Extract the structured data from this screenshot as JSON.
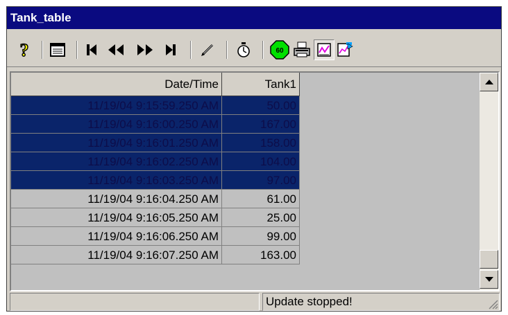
{
  "window": {
    "title": "Tank_table"
  },
  "toolbar": {
    "buttons": [
      {
        "name": "help-icon"
      },
      {
        "name": "properties-icon"
      },
      {
        "name": "first-record-icon"
      },
      {
        "name": "previous-page-icon"
      },
      {
        "name": "next-page-icon"
      },
      {
        "name": "last-record-icon"
      },
      {
        "name": "edit-icon"
      },
      {
        "name": "time-range-icon"
      },
      {
        "name": "stop-icon",
        "label": "60"
      },
      {
        "name": "print-icon"
      },
      {
        "name": "trend-icon"
      },
      {
        "name": "export-icon"
      }
    ]
  },
  "table": {
    "columns": [
      "Date/Time",
      "Tank1"
    ],
    "rows": [
      {
        "datetime": "11/19/04 9:15:59.250 AM",
        "value": "50.00",
        "selected": true
      },
      {
        "datetime": "11/19/04 9:16:00.250 AM",
        "value": "167.00",
        "selected": true
      },
      {
        "datetime": "11/19/04 9:16:01.250 AM",
        "value": "158.00",
        "selected": true
      },
      {
        "datetime": "11/19/04 9:16:02.250 AM",
        "value": "104.00",
        "selected": true
      },
      {
        "datetime": "11/19/04 9:16:03.250 AM",
        "value": "97.00",
        "selected": true
      },
      {
        "datetime": "11/19/04 9:16:04.250 AM",
        "value": "61.00",
        "selected": false
      },
      {
        "datetime": "11/19/04 9:16:05.250 AM",
        "value": "25.00",
        "selected": false
      },
      {
        "datetime": "11/19/04 9:16:06.250 AM",
        "value": "99.00",
        "selected": false
      },
      {
        "datetime": "11/19/04 9:16:07.250 AM",
        "value": "163.00",
        "selected": false
      }
    ]
  },
  "status": {
    "left": "",
    "message": "Update stopped!"
  },
  "colors": {
    "titlebar": "#0a0a80",
    "selection": "#0a246a",
    "stop_button": "#00e000"
  }
}
